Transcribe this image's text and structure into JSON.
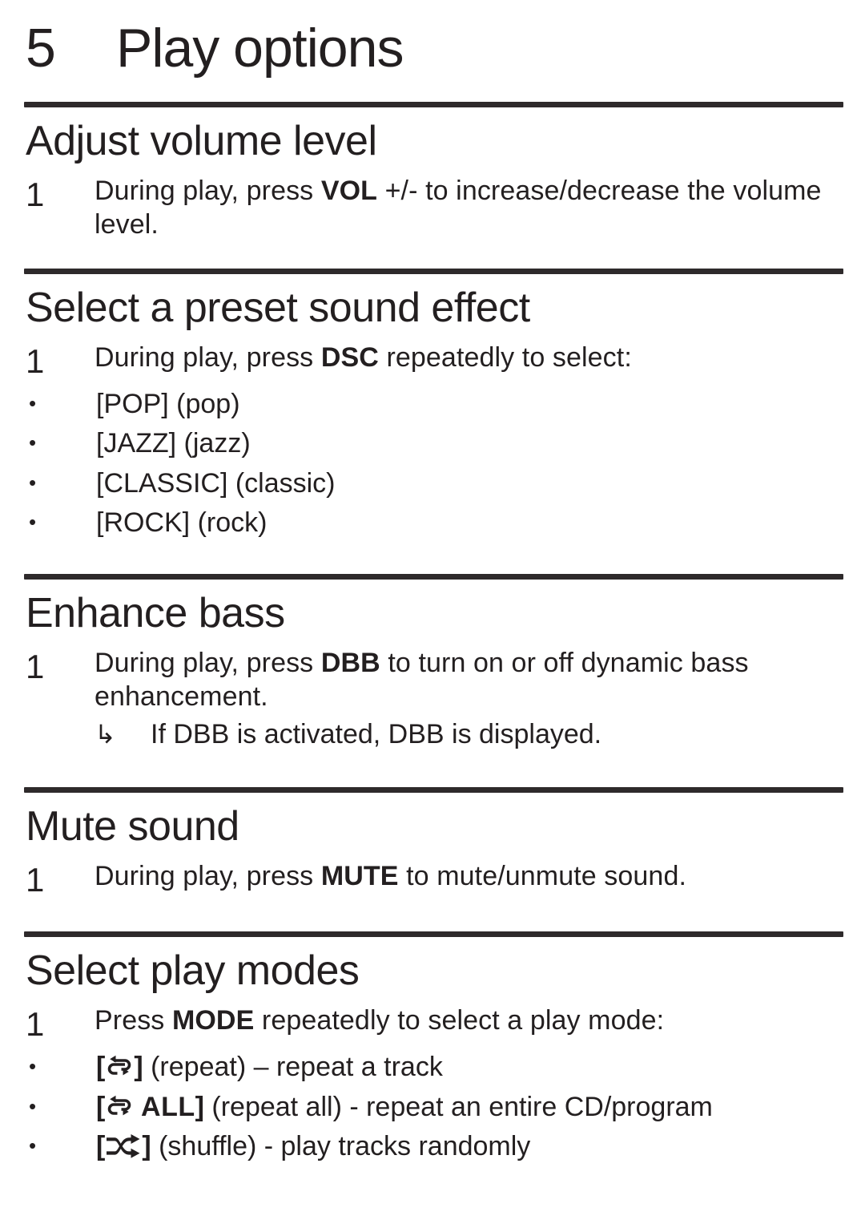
{
  "chapter": {
    "number": "5",
    "title": "Play options"
  },
  "sections": [
    {
      "id": "adjust-volume",
      "title": "Adjust volume level",
      "step_number": "1",
      "step_parts": [
        {
          "text": "During play, press ",
          "bold": false
        },
        {
          "text": "VOL",
          "bold": true
        },
        {
          "text": " +/- to increase/decrease the volume level.",
          "bold": false
        }
      ]
    },
    {
      "id": "preset-sound-effect",
      "title": "Select a preset sound effect",
      "step_number": "1",
      "step_parts": [
        {
          "text": "During play, press ",
          "bold": false
        },
        {
          "text": "DSC",
          "bold": true
        },
        {
          "text": " repeatedly to select:",
          "bold": false
        }
      ],
      "bullets": [
        {
          "marker": "•",
          "label": "[POP] (pop)"
        },
        {
          "marker": "•",
          "label": "[JAZZ] (jazz)"
        },
        {
          "marker": "•",
          "label": "[CLASSIC] (classic)"
        },
        {
          "marker": "•",
          "label": "[ROCK] (rock)"
        }
      ]
    },
    {
      "id": "enhance-bass",
      "title": "Enhance bass",
      "step_number": "1",
      "step_parts": [
        {
          "text": "During play, press ",
          "bold": false
        },
        {
          "text": "DBB",
          "bold": true
        },
        {
          "text": " to turn on or off dynamic bass enhancement.",
          "bold": false
        }
      ],
      "subnote": {
        "arrow": "↳",
        "text": "If DBB is activated, DBB is displayed."
      }
    },
    {
      "id": "mute-sound",
      "title": "Mute sound",
      "step_number": "1",
      "step_parts": [
        {
          "text": "During play, press ",
          "bold": false
        },
        {
          "text": "MUTE",
          "bold": true
        },
        {
          "text": " to mute/unmute sound.",
          "bold": false
        }
      ]
    },
    {
      "id": "select-play-modes",
      "title": "Select play modes",
      "step_number": "1",
      "step_parts": [
        {
          "text": "Press ",
          "bold": false
        },
        {
          "text": "MODE",
          "bold": true
        },
        {
          "text": " repeatedly to select a play mode:",
          "bold": false
        }
      ],
      "mode_bullets": [
        {
          "marker": "•",
          "icon": "repeat-icon",
          "bracket_open": "[",
          "bracket_close": "]",
          "inner_label": "",
          "description": " (repeat) – repeat a track"
        },
        {
          "marker": "•",
          "icon": "repeat-all-icon",
          "bracket_open": "[",
          "bracket_close": "]",
          "inner_label": " ALL",
          "description": " (repeat all) - repeat an entire CD/program"
        },
        {
          "marker": "•",
          "icon": "shuffle-icon",
          "bracket_open": "[",
          "bracket_close": "]",
          "inner_label": "",
          "description": " (shuffle) - play tracks randomly"
        }
      ]
    }
  ],
  "colors": {
    "text": "#231f20",
    "rule": "#2e2a2b",
    "background": "#ffffff"
  }
}
